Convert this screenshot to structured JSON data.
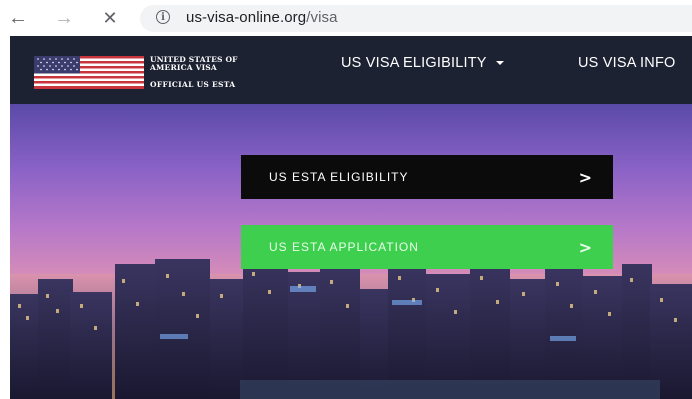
{
  "browser": {
    "back_icon": "arrow-left-icon",
    "forward_icon": "arrow-right-icon",
    "stop_icon": "close-icon",
    "info_icon": "info-icon",
    "url_domain": "us-visa-online.org",
    "url_path": "/visa"
  },
  "header": {
    "brand_line1": "UNITED STATES OF AMERICA VISA",
    "brand_line2": "OFFICIAL US ESTA",
    "nav": [
      {
        "label": "US VISA ELIGIBILITY"
      },
      {
        "label": "US VISA INFO"
      }
    ]
  },
  "hero": {
    "buttons": [
      {
        "label": "US ESTA ELIGIBILITY",
        "arrow": ">"
      },
      {
        "label": "US ESTA APPLICATION",
        "arrow": ">"
      }
    ]
  },
  "colors": {
    "header_bg": "#1d2233",
    "cta_dark": "#0b0b0b",
    "cta_green": "#3fcf4f"
  }
}
